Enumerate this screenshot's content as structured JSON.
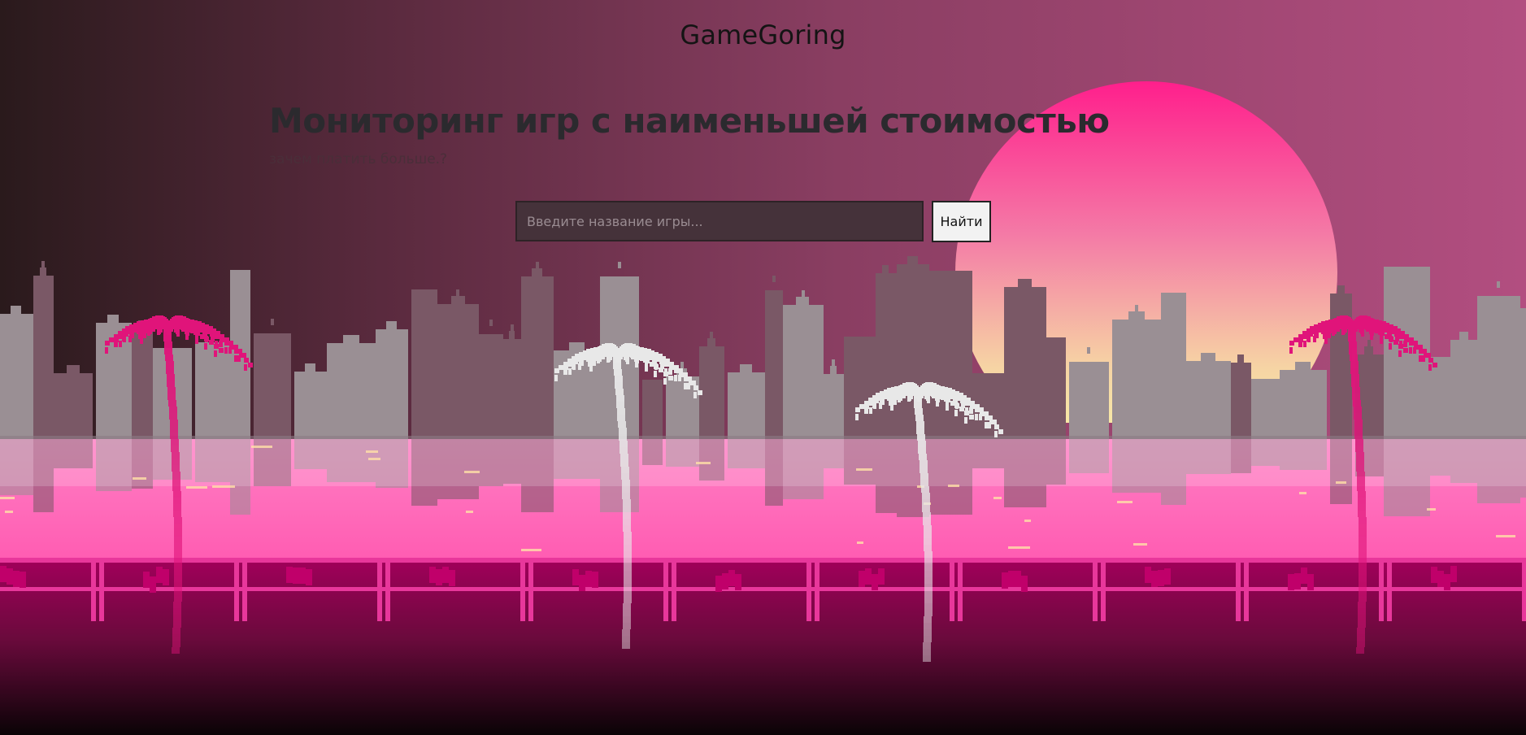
{
  "app": {
    "title": "GameGoring"
  },
  "hero": {
    "headline": "Мониторинг игр с наименьшей стоимостью",
    "tagline": "зачем платить больше.?"
  },
  "search": {
    "placeholder": "Введите название игры...",
    "value": "",
    "button_label": "Найти"
  },
  "background": {
    "scene": "pixel-art synthwave city skyline with palm trees over water",
    "colors": {
      "sky_left": "#2a1a1c",
      "sky_right": "#b04d7e",
      "sun_top": "#ff1f8c",
      "sun_bottom": "#f8f6a8",
      "water": "#ff66bb",
      "rail": "#e8379b",
      "pink_palm": "#e0147a",
      "white_palm": "#e8e8e8"
    }
  }
}
